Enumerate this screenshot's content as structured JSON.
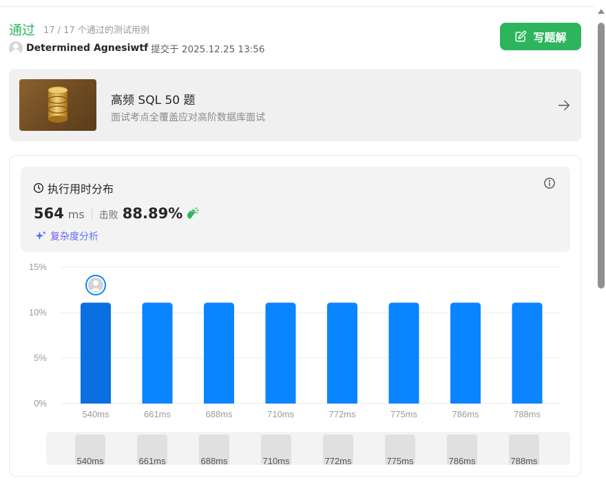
{
  "header": {
    "status": "通过",
    "testcases": "17 / 17 个通过的测试用例",
    "username": "Determined Agnesiwtf",
    "submitted": "提交于 2025.12.25 13:56",
    "write_solution_label": "写题解",
    "accent_color": "#2db55d"
  },
  "study_plan": {
    "title": "高频 SQL 50 题",
    "description": "面试考点全覆盖应对高阶数据库面试",
    "icon": "database-icon"
  },
  "runtime": {
    "title": "执行用时分布",
    "value": "564",
    "unit": "ms",
    "beat_label": "击败",
    "beat_percent": "88.89%",
    "complexity_label": "复杂度分析"
  },
  "chart_data": {
    "type": "bar",
    "categories": [
      "540ms",
      "661ms",
      "688ms",
      "710ms",
      "772ms",
      "775ms",
      "786ms",
      "788ms"
    ],
    "values": [
      11.1,
      11.1,
      11.1,
      11.1,
      11.1,
      11.1,
      11.1,
      11.1
    ],
    "y_ticks": [
      "0%",
      "5%",
      "10%",
      "15%"
    ],
    "ylim": [
      0,
      15
    ],
    "highlight_index": 0,
    "bar_color": "#0a84ff",
    "highlight_color": "#0a6fe0",
    "grid": true,
    "mini_track_values": [
      1,
      1,
      1,
      1,
      1,
      1,
      1,
      1
    ],
    "mini_track_labels": [
      "540ms",
      "661ms",
      "688ms",
      "710ms",
      "772ms",
      "775ms",
      "786ms",
      "788ms"
    ]
  }
}
